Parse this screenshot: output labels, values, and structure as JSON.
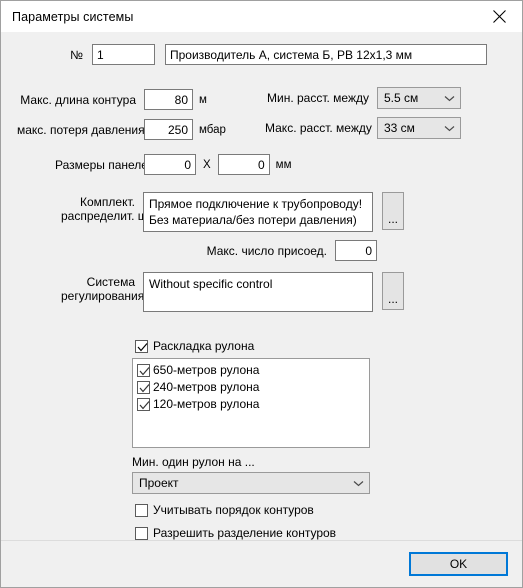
{
  "window": {
    "title": "Параметры системы",
    "close_icon": "close-icon"
  },
  "identity": {
    "number_label": "№",
    "number_value": "1",
    "description_value": "Производитель А, система Б, РВ 12x1,3 мм"
  },
  "limits": {
    "max_loop_length_label": "Макс. длина контура",
    "max_loop_length_value": "80",
    "max_loop_length_unit": "м",
    "max_pressure_loss_label": "макс. потеря давления",
    "max_pressure_loss_value": "250",
    "max_pressure_loss_unit": "мбар",
    "panel_size_label": "Размеры панелей",
    "panel_size_width": "0",
    "panel_size_separator": "X",
    "panel_size_height": "0",
    "panel_size_unit": "мм"
  },
  "spacing": {
    "min_spacing_label": "Мин. расст. между",
    "min_spacing_value": "5.5 см",
    "max_spacing_label": "Макс. расст. между",
    "max_spacing_value": "33 см"
  },
  "cabinet": {
    "label_line1": "Комплект.",
    "label_line2": "распределит. шкафа",
    "value": "Прямое подключение к трубопроводу!\nБез материала/без потери давления)",
    "browse_label": "...",
    "max_connections_label": "Макс. число присоед.",
    "max_connections_value": "0"
  },
  "control": {
    "label_line1": "Система",
    "label_line2": "регулирования",
    "value": "Without specific control",
    "browse_label": "..."
  },
  "roll": {
    "layout_checkbox_label": "Раскладка рулона",
    "layout_checked": true,
    "items": [
      {
        "label": "650-метров рулона",
        "checked": true
      },
      {
        "label": "240-метров рулона",
        "checked": true
      },
      {
        "label": "120-метров рулона",
        "checked": true
      }
    ],
    "min_one_roll_label": "Мин. один рулон на ...",
    "min_one_roll_value": "Проект",
    "consider_order_label": "Учитывать порядок контуров",
    "consider_order_checked": false,
    "allow_split_label": "Разрешить разделение контуров",
    "allow_split_checked": false
  },
  "footer": {
    "ok_label": "OK"
  },
  "colors": {
    "accent": "#0078d7",
    "dialog_bg": "#f0f0f0",
    "field_bg": "#ffffff",
    "combo_bg": "#e6e6e6"
  }
}
